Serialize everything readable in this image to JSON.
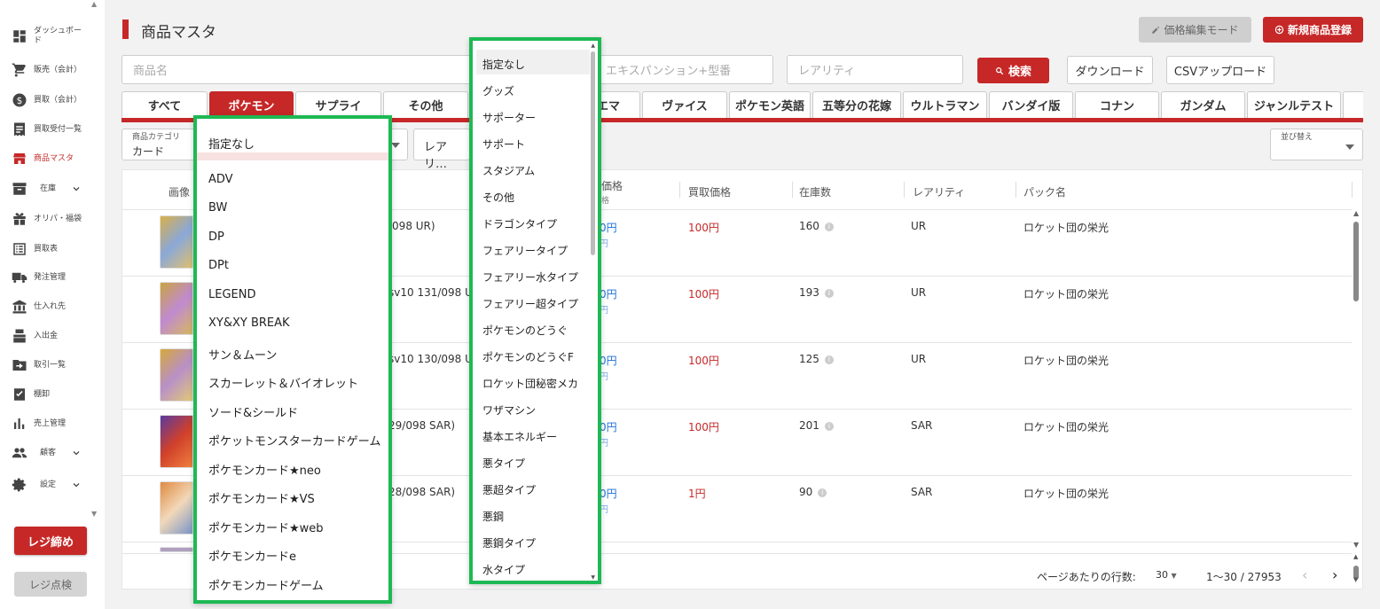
{
  "sidebar": {
    "items": [
      {
        "label": "ダッシュボード",
        "icon": "dashboard-icon"
      },
      {
        "label": "販売（会計）",
        "icon": "cart-icon"
      },
      {
        "label": "買取（会計）",
        "icon": "dollar-icon"
      },
      {
        "label": "買取受付一覧",
        "icon": "receipt-icon"
      },
      {
        "label": "商品マスタ",
        "icon": "store-icon"
      },
      {
        "label": "在庫",
        "icon": "inventory-icon"
      },
      {
        "label": "オリパ・福袋",
        "icon": "gift-icon"
      },
      {
        "label": "買取表",
        "icon": "list-icon"
      },
      {
        "label": "発注管理",
        "icon": "truck-icon"
      },
      {
        "label": "仕入れ先",
        "icon": "bank-icon"
      },
      {
        "label": "入出金",
        "icon": "cashier-icon"
      },
      {
        "label": "取引一覧",
        "icon": "folder-arrow-icon"
      },
      {
        "label": "棚卸",
        "icon": "checklist-icon"
      },
      {
        "label": "売上管理",
        "icon": "bar-chart-icon"
      },
      {
        "label": "顧客",
        "icon": "people-icon"
      },
      {
        "label": "設定",
        "icon": "gear-icon"
      }
    ],
    "register_close": "レジ締め",
    "register_check": "レジ点検"
  },
  "header": {
    "title": "商品マスタ",
    "price_edit_mode": "価格編集モード",
    "new_product": "新規商品登録"
  },
  "search": {
    "name_placeholder": "商品名",
    "expansion_placeholder": "エキスパンション+型番",
    "rarity_placeholder": "レアリティ",
    "search_button": "検索",
    "download_button": "ダウンロード",
    "csv_upload_button": "CSVアップロード"
  },
  "tabs": [
    "すべて",
    "ポケモン",
    "サプライ",
    "その他",
    "",
    "エマ",
    "ヴァイス",
    "ポケモン英語",
    "五等分の花嫁",
    "ウルトラマン",
    "バンダイ版",
    "コナン",
    "ガンダム",
    "ジャンルテスト"
  ],
  "filters": {
    "category_label": "商品カテゴリ",
    "category_value": "カード",
    "rarity_value": "レアリ…",
    "sort_label": "並び替え"
  },
  "table": {
    "headers": [
      "画像",
      "価格",
      "買取価格",
      "在庫数",
      "レアリティ",
      "パック名"
    ],
    "price_sub": "格",
    "rows": [
      {
        "model": "/098 UR)",
        "price": "0円",
        "buy": "100円",
        "stock": "160",
        "rarity": "UR",
        "pack": "ロケット団の栄光"
      },
      {
        "model": "sv10 131/098 U",
        "price": "0円",
        "buy": "100円",
        "stock": "193",
        "rarity": "UR",
        "pack": "ロケット団の栄光"
      },
      {
        "model": "sv10 130/098 U",
        "price": "0円",
        "buy": "100円",
        "stock": "125",
        "rarity": "UR",
        "pack": "ロケット団の栄光"
      },
      {
        "model": "29/098 SAR)",
        "price": "0円",
        "buy": "100円",
        "stock": "201",
        "rarity": "SAR",
        "pack": "ロケット団の栄光"
      },
      {
        "model": "28/098 SAR)",
        "price": "0円",
        "buy": "1円",
        "stock": "90",
        "rarity": "SAR",
        "pack": "ロケット団の栄光"
      }
    ],
    "price_sub_rows": [
      "円",
      "円",
      "円",
      "円",
      "円"
    ]
  },
  "pager": {
    "rows_per_page_label": "ページあたりの行数:",
    "rows_per_page": "30",
    "range": "1〜30 / 27953"
  },
  "dropdown_series": {
    "items": [
      "指定なし",
      "ADV",
      "BW",
      "DP",
      "DPt",
      "LEGEND",
      "XY&XY BREAK",
      "サン＆ムーン",
      "スカーレット＆バイオレット",
      "ソード&シールド",
      "ポケットモンスターカードゲーム",
      "ポケモンカード★neo",
      "ポケモンカード★VS",
      "ポケモンカード★web",
      "ポケモンカードe",
      "ポケモンカードゲーム"
    ]
  },
  "dropdown_type": {
    "items": [
      "指定なし",
      "グッズ",
      "サポーター",
      "サポート",
      "スタジアム",
      "その他",
      "ドラゴンタイプ",
      "フェアリータイプ",
      "フェアリー水タイプ",
      "フェアリー超タイプ",
      "ポケモンのどうぐ",
      "ポケモンのどうぐF",
      "ロケット団秘密メカ",
      "ワザマシン",
      "基本エネルギー",
      "悪タイプ",
      "悪超タイプ",
      "悪鋼",
      "悪鋼タイプ",
      "水タイプ"
    ]
  },
  "colors": {
    "accent": "#c62828",
    "highlight": "#1db954"
  }
}
